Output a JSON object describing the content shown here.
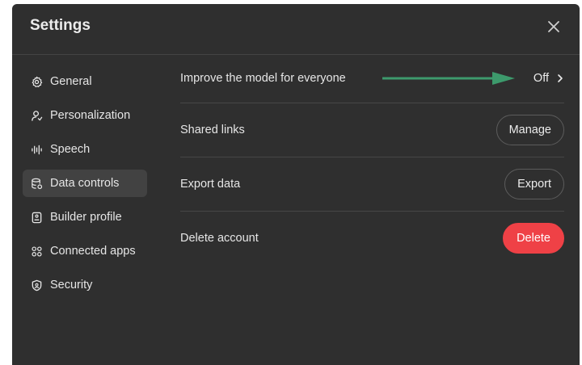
{
  "dialog": {
    "title": "Settings"
  },
  "sidebar": {
    "items": [
      {
        "label": "General",
        "icon": "gear-icon",
        "active": false
      },
      {
        "label": "Personalization",
        "icon": "person-icon",
        "active": false
      },
      {
        "label": "Speech",
        "icon": "waveform-icon",
        "active": false
      },
      {
        "label": "Data controls",
        "icon": "database-icon",
        "active": true
      },
      {
        "label": "Builder profile",
        "icon": "id-card-icon",
        "active": false
      },
      {
        "label": "Connected apps",
        "icon": "apps-grid-icon",
        "active": false
      },
      {
        "label": "Security",
        "icon": "shield-icon",
        "active": false
      }
    ]
  },
  "data_controls": {
    "improve_model": {
      "label": "Improve the model for everyone",
      "value": "Off"
    },
    "shared_links": {
      "label": "Shared links",
      "button": "Manage"
    },
    "export_data": {
      "label": "Export data",
      "button": "Export"
    },
    "delete_account": {
      "label": "Delete account",
      "button": "Delete"
    }
  },
  "colors": {
    "modal_bg": "#2f2f2f",
    "active_item_bg": "#424242",
    "danger": "#ef4146",
    "annotation_arrow": "#3d9a6c"
  }
}
